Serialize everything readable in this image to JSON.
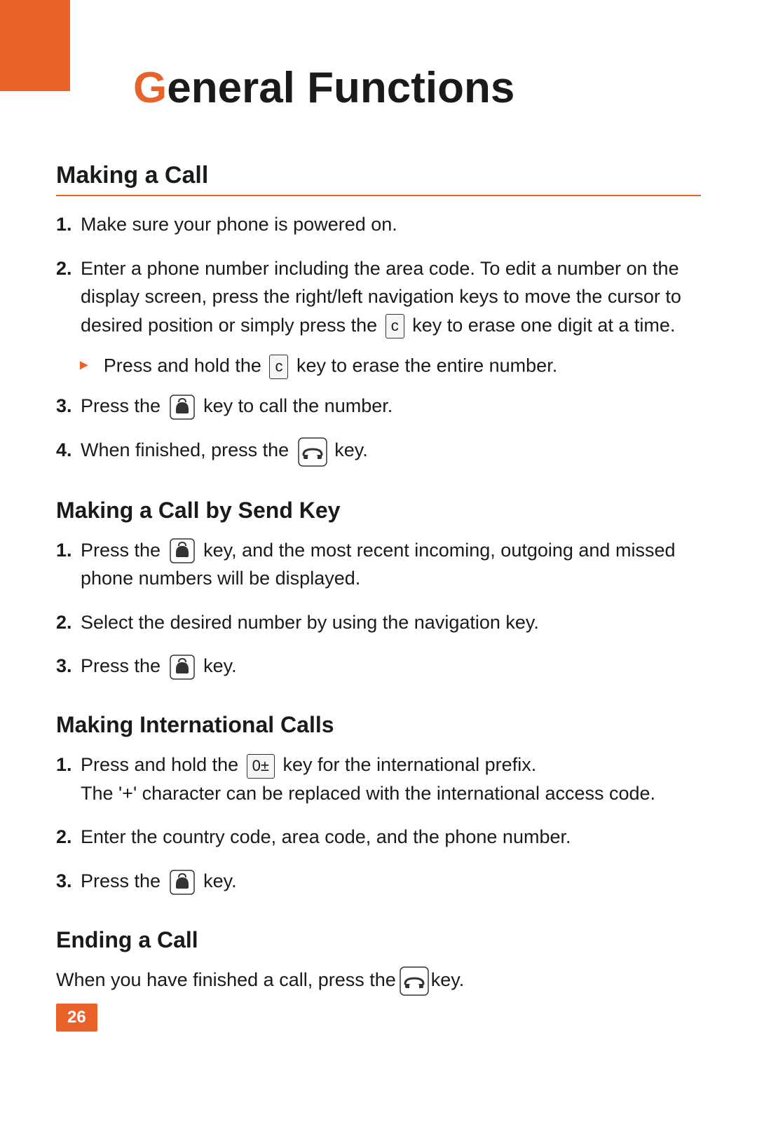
{
  "page": {
    "title_prefix": "",
    "title_G": "G",
    "title_rest": "eneral Functions",
    "accent_color": "#e8622a",
    "page_number": "26"
  },
  "making_a_call": {
    "heading": "Making a Call",
    "steps": [
      {
        "num": "1.",
        "text": "Make sure your phone is powered on."
      },
      {
        "num": "2.",
        "text": "Enter a phone number including the area code. To edit a number on the display screen, press the right/left navigation keys to move the cursor to desired position or simply press the",
        "key": "c",
        "text_after": "key to erase one digit at a time."
      }
    ],
    "bullet": {
      "text_before": "Press and hold the",
      "key": "c",
      "text_after": "key to erase the entire number."
    },
    "step3": {
      "num": "3.",
      "text_before": "Press the",
      "key": "send",
      "text_after": "key to call the number."
    },
    "step4": {
      "num": "4.",
      "text_before": "When finished, press the",
      "key": "end",
      "text_after": "key."
    }
  },
  "making_by_send": {
    "heading": "Making a Call by Send Key",
    "steps": [
      {
        "num": "1.",
        "text_before": "Press the",
        "key": "send",
        "text_after": "key, and the most recent incoming, outgoing and missed phone numbers will be displayed."
      },
      {
        "num": "2.",
        "text": "Select the desired number by using the navigation key."
      },
      {
        "num": "3.",
        "text_before": "Press the",
        "key": "send",
        "text_after": "key."
      }
    ]
  },
  "making_international": {
    "heading": "Making International Calls",
    "steps": [
      {
        "num": "1.",
        "text_before": "Press and hold the",
        "key": "zero",
        "text_after": "key for the international prefix.",
        "line2": "The '+' character can be replaced with the international access code."
      },
      {
        "num": "2.",
        "text": "Enter the country code, area code, and the phone number."
      },
      {
        "num": "3.",
        "text_before": "Press the",
        "key": "send",
        "text_after": "key."
      }
    ]
  },
  "ending_a_call": {
    "heading": "Ending a Call",
    "text_before": "When you have finished a call, press the",
    "key": "end",
    "text_after": "key."
  }
}
